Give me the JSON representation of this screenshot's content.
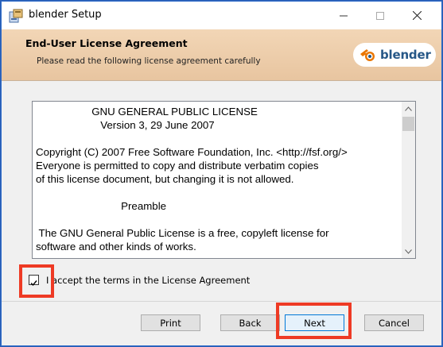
{
  "window": {
    "title": "blender Setup",
    "controls": {
      "minimize": "—",
      "maximize": "☐",
      "close": "✕"
    }
  },
  "banner": {
    "title": "End-User License Agreement",
    "subtitle": "Please read the following license agreement carefully",
    "logo_text": "blender"
  },
  "license": {
    "lines": [
      "                   GNU GENERAL PUBLIC LICENSE",
      "                      Version 3, 29 June 2007",
      "",
      "Copyright (C) 2007 Free Software Foundation, Inc. <http://fsf.org/>",
      "Everyone is permitted to copy and distribute verbatim copies",
      "of this license document, but changing it is not allowed.",
      "",
      "                             Preamble",
      "",
      " The GNU General Public License is a free, copyleft license for",
      "software and other kinds of works."
    ]
  },
  "accept": {
    "label": "I accept the terms in the License Agreement",
    "checked": true
  },
  "buttons": {
    "print": "Print",
    "back": "Back",
    "next": "Next",
    "cancel": "Cancel"
  },
  "colors": {
    "highlight": "#ee3a24",
    "banner": "#f2d6b6",
    "accent": "#0078d7"
  }
}
